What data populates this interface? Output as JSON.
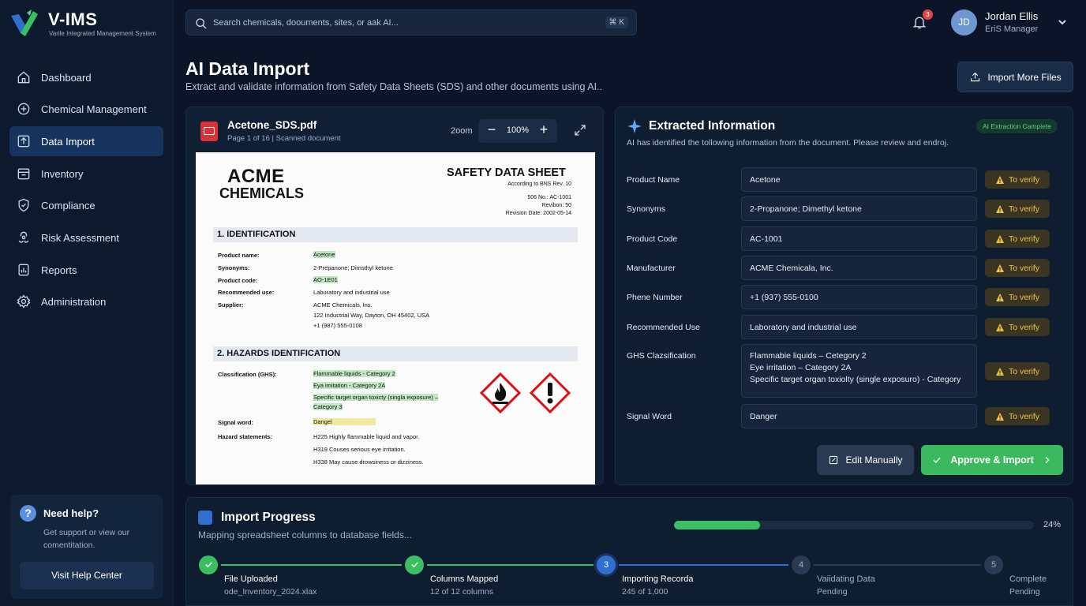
{
  "app": {
    "name": "V-IMS",
    "tagline": "Varile Integrated Management System"
  },
  "search": {
    "placeholder": "Search chemicals, doouments, sites, or aak AI...",
    "shortcut": "⌘ K"
  },
  "notifications": {
    "count": "3"
  },
  "user": {
    "initials": "JD",
    "name": "Jordan Ellis",
    "role": "EriS Manager"
  },
  "sidebar": {
    "items": [
      {
        "label": "Dashboard",
        "icon": "home-icon"
      },
      {
        "label": "Chemical Management",
        "icon": "flask-icon"
      },
      {
        "label": "Data Import",
        "icon": "upload-icon",
        "active": true
      },
      {
        "label": "Inventory",
        "icon": "inventory-icon"
      },
      {
        "label": "Compliance",
        "icon": "shield-icon"
      },
      {
        "label": "Risk Assessment",
        "icon": "hazard-icon"
      },
      {
        "label": "Reports",
        "icon": "report-icon"
      },
      {
        "label": "Administration",
        "icon": "gear-icon"
      }
    ],
    "help": {
      "title": "Need help?",
      "text": "Get support or view our comentitation.",
      "button": "Visit Help Center"
    }
  },
  "page": {
    "title": "AI Data Import",
    "subtitle": "Extract and validate information from Safety Data Sheets (SDS) and other documents using AI..",
    "import_button": "Import More Files"
  },
  "document": {
    "filename": "Acetone_SDS.pdf",
    "meta": "Page 1 of 16  |  Scanned document",
    "zoom_label": "2oom",
    "zoom_value": "100%",
    "zoom_minus": "−",
    "zoom_plus": "+",
    "sheet": {
      "company_line1": "ACME",
      "company_line2": "CHEMICALS",
      "title": "SAFETY DATA SHEET",
      "meta1": "According to BNS Rev. 10",
      "meta2": "506 No.: AC-1001",
      "meta3": "Revibon: 50",
      "meta4": "Revision Date: 2002-05-14",
      "section1": "1. IDENTIFICATION",
      "ident": [
        {
          "label": "Product name:",
          "value": "Acetone"
        },
        {
          "label": "Synonyms:",
          "value": "2-Prepanone; Dimsthyl ketone"
        },
        {
          "label": "Product code:",
          "value": "AO-1E01"
        },
        {
          "label": "Recommended use:",
          "value": "Laburatory and industrial use"
        },
        {
          "label": "Supplier:",
          "value": "ACME Chemicals, lns."
        }
      ],
      "supplier_addr1": "122 Inductrial Way, Dayton, OH 45402, USA",
      "supplier_addr2": "+1 (987) 555-0108",
      "section2": "2. HAZARDS IDENTIFICATION",
      "class_label": "Classification (GHS):",
      "class_values": [
        "Flammable liquids - Category 2",
        "Eya imitation - Category 2A",
        "Specific target organ toxicty (singla exposure) –",
        "Category 3"
      ],
      "signal_label": "Signal word:",
      "signal_value": "Dangel",
      "hazard_label": "Hazard statements:",
      "hazard_values": [
        "H225 Highly flammable liquid and vapor.",
        "H319 Couses serious eye irritation.",
        "H338 May cause drowsiness or dizziness."
      ]
    }
  },
  "extracted": {
    "title": "Extracted Information",
    "status": "AI Extraction Campiete",
    "description": "AI has identified the tollowing information from the document. Please review and endrој.",
    "verify_label": "To verify",
    "fields": [
      {
        "label": "Product Name",
        "value": "Acetone"
      },
      {
        "label": "Synonyms",
        "value": "2-Propanone; Dimethyl ketone"
      },
      {
        "label": "Product Code",
        "value": "AC-1001"
      },
      {
        "label": "Manufacturer",
        "value": "ACME Chemicala, Inc."
      },
      {
        "label": "Phene Number",
        "value": "+1 (937) 555-0100"
      },
      {
        "label": "Recommended Use",
        "value": "Laboratory and industrial use"
      }
    ],
    "ghs": {
      "label": "GHS Clazsification",
      "lines": [
        "Flammabie liquids – Cetegory 2",
        "Eye irritation – Category 2A",
        "Specific target organ toxiolty (single exposuro) - Category"
      ]
    },
    "signal": {
      "label": "Signal Word",
      "value": "Danger"
    },
    "edit_button": "Edit Manually",
    "approve_button": "Approve & Import"
  },
  "progress": {
    "title": "Import Progress",
    "subtitle": "Mapping spreadsheet columns to database fields...",
    "percent": 24,
    "percent_label": "24%",
    "steps": [
      {
        "num": "1",
        "title": "File Uploaded",
        "detail": "ode_Inventory_2024.xlax",
        "state": "done"
      },
      {
        "num": "2",
        "title": "Columns Mapped",
        "detail": "12 of 12 columns",
        "state": "done"
      },
      {
        "num": "3",
        "title": "Importing Recorda",
        "detail": "245 of 1,000",
        "state": "active"
      },
      {
        "num": "4",
        "title": "Vaiidating Data",
        "detail": "Pending",
        "state": "pending"
      },
      {
        "num": "5",
        "title": "Complete",
        "detail": "Pending",
        "state": "pending"
      }
    ]
  },
  "colors": {
    "accent": "#2f6fd0",
    "success": "#3bbf63",
    "warning": "#f0c24a",
    "background": "#0b1527"
  }
}
